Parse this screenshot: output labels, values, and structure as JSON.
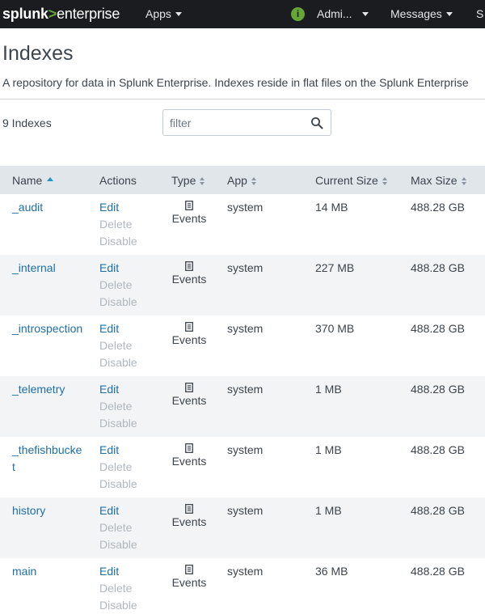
{
  "topbar": {
    "logo": {
      "part1": "splunk",
      "part2": ">",
      "part3": "enterprise"
    },
    "apps_label": "Apps",
    "info_glyph": "i",
    "user_label": "Admi...",
    "messages_label": "Messages",
    "settings_label": "S"
  },
  "page": {
    "title": "Indexes",
    "description": "A repository for data in Splunk Enterprise. Indexes reside in flat files on the Splunk Enterprise"
  },
  "toolbar": {
    "count_label": "9 Indexes",
    "filter_placeholder": "filter"
  },
  "table": {
    "columns": {
      "name": "Name",
      "actions": "Actions",
      "type": "Type",
      "app": "App",
      "current_size": "Current Size",
      "max_size": "Max Size"
    },
    "rows": [
      {
        "name": "_audit",
        "edit": "Edit",
        "delete": "Delete",
        "disable": "Disable",
        "type": "Events",
        "app": "system",
        "current_size": "14 MB",
        "max_size": "488.28 GB"
      },
      {
        "name": "_internal",
        "edit": "Edit",
        "delete": "Delete",
        "disable": "Disable",
        "type": "Events",
        "app": "system",
        "current_size": "227 MB",
        "max_size": "488.28 GB"
      },
      {
        "name": "_introspection",
        "edit": "Edit",
        "delete": "Delete",
        "disable": "Disable",
        "type": "Events",
        "app": "system",
        "current_size": "370 MB",
        "max_size": "488.28 GB"
      },
      {
        "name": "_telemetry",
        "edit": "Edit",
        "delete": "Delete",
        "disable": "Disable",
        "type": "Events",
        "app": "system",
        "current_size": "1 MB",
        "max_size": "488.28 GB"
      },
      {
        "name": "_thefishbucket",
        "edit": "Edit",
        "delete": "Delete",
        "disable": "Disable",
        "type": "Events",
        "app": "system",
        "current_size": "1 MB",
        "max_size": "488.28 GB"
      },
      {
        "name": "history",
        "edit": "Edit",
        "delete": "Delete",
        "disable": "Disable",
        "type": "Events",
        "app": "system",
        "current_size": "1 MB",
        "max_size": "488.28 GB"
      },
      {
        "name": "main",
        "edit": "Edit",
        "delete": "Delete",
        "disable": "Disable",
        "type": "Events",
        "app": "system",
        "current_size": "36 MB",
        "max_size": "488.28 GB"
      }
    ]
  },
  "colors": {
    "topbar_bg": "#1a1c20",
    "brand_green": "#65a637",
    "link_blue": "#1e6fa9",
    "header_bg": "#e1e6eb",
    "row_alt_bg": "#f2f4f5"
  },
  "icons": {
    "info": "info-icon",
    "search": "search-icon",
    "event_type": "document-icon",
    "sort": "sort-icon",
    "sort_ascending": "sort-ascending-icon"
  }
}
